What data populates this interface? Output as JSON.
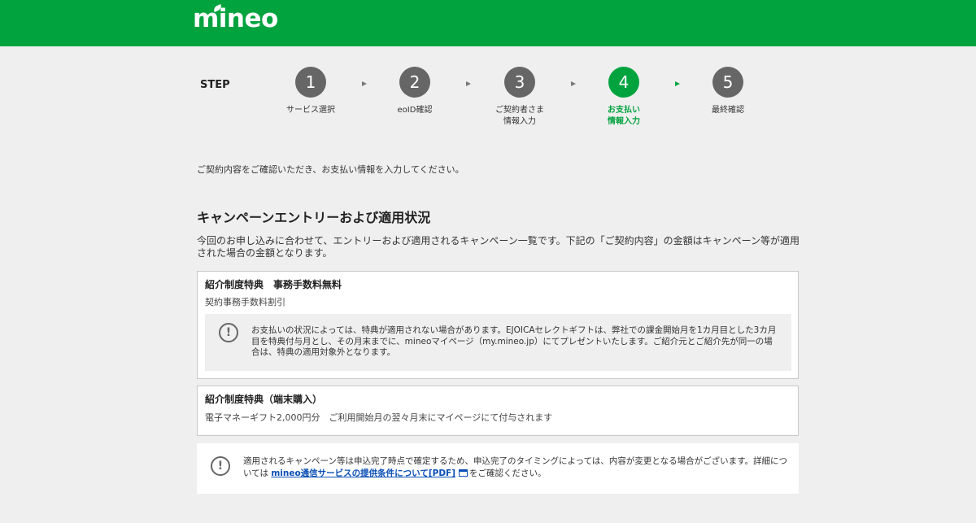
{
  "header": {
    "logo": "mineo",
    "color": "#00a33e"
  },
  "stepper": {
    "label": "STEP",
    "steps": [
      {
        "number": "1",
        "name": "サービス選択"
      },
      {
        "number": "2",
        "name": "eoID確認"
      },
      {
        "number": "3",
        "name": "ご契約者さま\n情報入力"
      },
      {
        "number": "4",
        "name": "お支払い\n情報入力"
      },
      {
        "number": "5",
        "name": "最終確認"
      }
    ],
    "active_step": "4"
  },
  "intro": "ご契約内容をご確認いただき、お支払い情報を入力してください。",
  "campaign": {
    "title": "キャンペーンエントリーおよび適用状況",
    "description": "今回のお申し込みに合わせて、エントリーおよび適用されるキャンペーン一覧です。下記の「ご契約内容」の金額はキャンペーン等が適用された場合の金額となります。",
    "items": [
      {
        "title": "紹介制度特典　事務手数料無料",
        "subtitle": "契約事務手数料割引",
        "notice": "お支払いの状況によっては、特典が適用されない場合があります。EJOICAセレクトギフトは、弊社での課金開始月を1カ月目とした3カ月目を特典付与月とし、その月末までに、mineoマイページ（my.mineo.jp）にてプレゼントいたします。ご紹介元とご紹介先が同一の場合は、特典の適用対象外となります。"
      },
      {
        "title": "紹介制度特典（端末購入）",
        "subtitle": "電子マネーギフト2,000円分　ご利用開始月の翌々月末にマイページにて付与されます"
      }
    ]
  },
  "footer_note": {
    "text_before": "適用されるキャンペーン等は申込完了時点で確定するため、申込完了のタイミングによっては、内容が変更となる場合がございます。詳細については ",
    "link": "mineo通信サービスの提供条件について[PDF]",
    "text_after": "をご確認ください。"
  },
  "icons": {
    "alert": "exclamation-circle-icon",
    "external": "external-window-icon"
  }
}
